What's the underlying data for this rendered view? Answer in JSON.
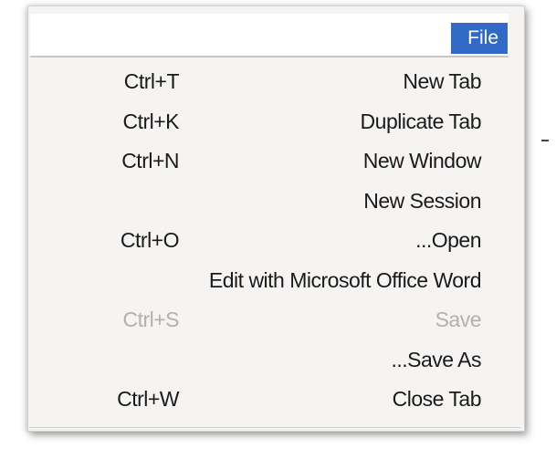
{
  "menubar": {
    "file_label": "File"
  },
  "menu": {
    "items": [
      {
        "shortcut": "Ctrl+T",
        "label": "New Tab"
      },
      {
        "shortcut": "Ctrl+K",
        "label": "Duplicate Tab"
      },
      {
        "shortcut": "Ctrl+N",
        "label": "New Window"
      },
      {
        "shortcut": "",
        "label": "New Session"
      },
      {
        "shortcut": "Ctrl+O",
        "label": "...Open"
      },
      {
        "shortcut": "",
        "label": "Edit with Microsoft Office Word"
      },
      {
        "shortcut": "Ctrl+S",
        "label": "Save",
        "disabled": true
      },
      {
        "shortcut": "",
        "label": "...Save As"
      },
      {
        "shortcut": "Ctrl+W",
        "label": "Close Tab"
      }
    ]
  },
  "colors": {
    "accent": "#3269c7",
    "disabled_text": "#b3b1ae",
    "panel_background": "#f5f4f2"
  }
}
